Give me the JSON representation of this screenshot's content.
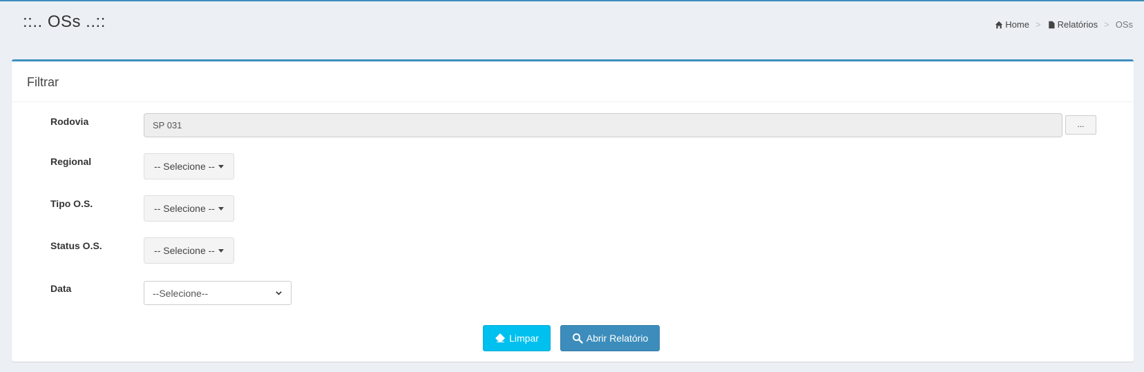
{
  "header": {
    "title": "::.. OSs ..::",
    "breadcrumb": {
      "home": "Home",
      "reports": "Relatórios",
      "current": "OSs",
      "separator": ">"
    }
  },
  "panel": {
    "title": "Filtrar"
  },
  "form": {
    "rodovia": {
      "label": "Rodovia",
      "value": "SP 031",
      "lookup_label": "..."
    },
    "regional": {
      "label": "Regional",
      "selected": "-- Selecione --"
    },
    "tipo_os": {
      "label": "Tipo O.S.",
      "selected": "-- Selecione --"
    },
    "status_os": {
      "label": "Status O.S.",
      "selected": "-- Selecione --"
    },
    "data": {
      "label": "Data",
      "selected": "--Selecione--"
    }
  },
  "actions": {
    "clear_label": "Limpar",
    "open_report_label": "Abrir Relatório"
  },
  "colors": {
    "primary": "#3c8dbc",
    "info": "#00c0ef",
    "background": "#ecf0f5"
  },
  "icons": {
    "home": "home-icon",
    "reports": "file-icon",
    "clear": "eraser-icon",
    "open_report": "search-icon",
    "select": "chevron-down-icon"
  }
}
